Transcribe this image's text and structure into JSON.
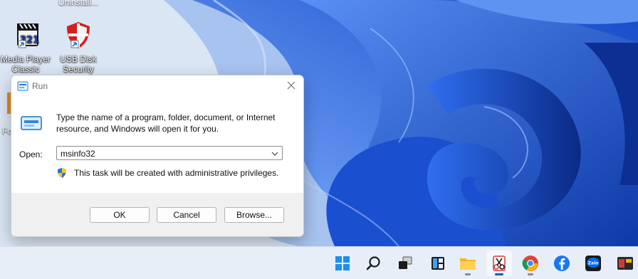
{
  "desktop": {
    "icons": [
      {
        "label_line1": "Media Player",
        "label_line2": "Classic"
      },
      {
        "label_line1": "USB Disk",
        "label_line2": "Security"
      }
    ],
    "top_partial_label": "Uninstall...",
    "edge_label": "Fo"
  },
  "dialog": {
    "title": "Run",
    "description": "Type the name of a program, folder, document, or Internet resource, and Windows will open it for you.",
    "open_label": "Open:",
    "open_value": "msinfo32",
    "admin_note": "This task will be created with administrative privileges.",
    "buttons": {
      "ok": "OK",
      "cancel": "Cancel",
      "browse": "Browse..."
    }
  },
  "taskbar": {
    "items": [
      "start-icon",
      "search-icon",
      "task-view-icon",
      "widgets-icon",
      "file-explorer-icon",
      "snipping-tool-icon",
      "chrome-icon",
      "facebook-icon",
      "zalo-icon"
    ],
    "zalo_label": "Zalo"
  },
  "colors": {
    "accent": "#005fb8",
    "wallpaper_blue": "#1f5fe0"
  }
}
